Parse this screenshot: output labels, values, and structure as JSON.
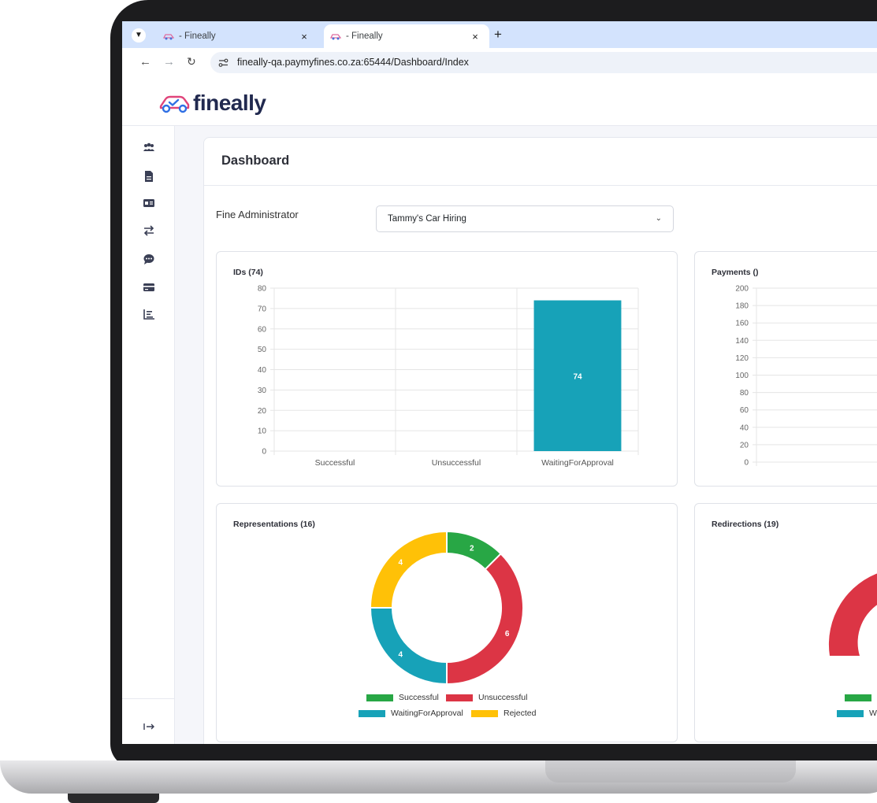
{
  "browser": {
    "tabs": [
      {
        "title": " - Fineally",
        "active": false
      },
      {
        "title": " - Fineally",
        "active": true
      }
    ],
    "close_icon": "×",
    "new_tab_icon": "+",
    "url": "fineally-qa.paymyfines.co.za:65444/Dashboard/Index"
  },
  "app": {
    "logo_text": "fineally",
    "sidebar_icons": [
      "users-icon",
      "document-icon",
      "id-card-icon",
      "transfer-icon",
      "chat-icon",
      "credit-card-icon",
      "report-icon",
      "logout-icon"
    ],
    "page_title": "Dashboard",
    "filter": {
      "label": "Fine Administrator",
      "value": "Tammy's Car Hiring"
    }
  },
  "colors": {
    "success": "#28a745",
    "danger": "#dc3545",
    "info": "#17a2b8",
    "warning": "#ffc107",
    "brand": "#21294f",
    "brand_accent": "#e0457b"
  },
  "chart_data": [
    {
      "type": "bar",
      "title": "IDs (74)",
      "categories": [
        "Successful",
        "Unsuccessful",
        "WaitingForApproval"
      ],
      "values": [
        0,
        0,
        74
      ],
      "ylim": [
        0,
        80
      ],
      "yticks": [
        0,
        10,
        20,
        30,
        40,
        50,
        60,
        70,
        80
      ],
      "grid": true,
      "data_labels": [
        "",
        "",
        "74"
      ]
    },
    {
      "type": "bar",
      "title": "Payments ()",
      "categories": [],
      "values": [],
      "ylim": [
        0,
        200
      ],
      "yticks": [
        0,
        20,
        40,
        60,
        80,
        100,
        120,
        140,
        160,
        180,
        200
      ],
      "grid": true
    },
    {
      "type": "pie",
      "title": "Representations (16)",
      "donut": true,
      "labels": [
        "Successful",
        "Unsuccessful",
        "WaitingForApproval",
        "Rejected"
      ],
      "values": [
        2,
        6,
        4,
        4
      ],
      "legend": "bottom"
    },
    {
      "type": "pie",
      "title": "Redirections (19)",
      "donut": true,
      "legend": "bottom",
      "visible_legend": [
        "S",
        "Wa"
      ]
    }
  ]
}
